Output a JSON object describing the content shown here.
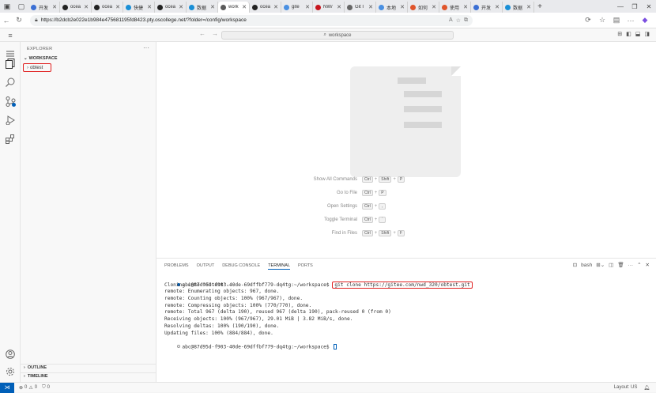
{
  "browser": {
    "tabs": [
      {
        "label": "开发",
        "color": "#3b6fd4"
      },
      {
        "label": "ocea",
        "color": "#222222"
      },
      {
        "label": "ocea",
        "color": "#222222"
      },
      {
        "label": "快捷",
        "color": "#1a8fd6"
      },
      {
        "label": "ocea",
        "color": "#222222"
      },
      {
        "label": "数据",
        "color": "#1a8fd6"
      },
      {
        "label": "work",
        "color": "#5a5a5a"
      },
      {
        "label": "ocea",
        "color": "#222222"
      },
      {
        "label": "gite",
        "color": "#4a90e2"
      },
      {
        "label": "NW/",
        "color": "#c7161e"
      },
      {
        "label": "Git I",
        "color": "#666666"
      },
      {
        "label": "本地",
        "color": "#4a90e2"
      },
      {
        "label": "如何",
        "color": "#e0552b"
      },
      {
        "label": "使用",
        "color": "#e0552b"
      },
      {
        "label": "开发",
        "color": "#3b6fd4"
      },
      {
        "label": "数据",
        "color": "#1a8fd6"
      }
    ],
    "active_tab_index": 6,
    "url": "https://b2dcb2e022e1b984e475681195fd8423.pty.oscollege.net/?folder=/config/workspace"
  },
  "vscode": {
    "command_center": "workspace",
    "explorer_title": "EXPLORER",
    "workspace_label": "WORKSPACE",
    "folder": "obtest",
    "outline": "OUTLINE",
    "timeline": "TIMELINE",
    "shortcuts": [
      {
        "label": "Show All Commands",
        "keys": [
          "Ctrl",
          "Shift",
          "P"
        ]
      },
      {
        "label": "Go to File",
        "keys": [
          "Ctrl",
          "P"
        ]
      },
      {
        "label": "Open Settings",
        "keys": [
          "Ctrl",
          ","
        ]
      },
      {
        "label": "Toggle Terminal",
        "keys": [
          "Ctrl",
          "`"
        ]
      },
      {
        "label": "Find in Files",
        "keys": [
          "Ctrl",
          "Shift",
          "F"
        ]
      }
    ],
    "panel_tabs": [
      "PROBLEMS",
      "OUTPUT",
      "DEBUG CONSOLE",
      "TERMINAL",
      "PORTS"
    ],
    "active_panel_tab": "TERMINAL",
    "terminal_name": "bash",
    "terminal": {
      "prompt": "abc@87d95d-f903-40de-69dffbf779-dq4tg:~/workspace$",
      "command": "git clone https://gitee.com/nwd_320/obtest.git",
      "output": [
        "Cloning into 'obtest'...",
        "remote: Enumerating objects: 967, done.",
        "remote: Counting objects: 100% (967/967), done.",
        "remote: Compressing objects: 100% (770/770), done.",
        "remote: Total 967 (delta 190), reused 967 (delta 190), pack-reused 0 (from 0)",
        "Receiving objects: 100% (967/967), 29.01 MiB | 3.82 MiB/s, done.",
        "Resolving deltas: 100% (190/190), done.",
        "Updating files: 100% (884/884), done."
      ],
      "prompt2": "abc@87d95d-f903-40de-69dffbf779-dq4tg:~/workspace$"
    },
    "status": {
      "errors": "0",
      "warnings": "0",
      "ports": "0",
      "layout": "Layout: US"
    },
    "colors": {
      "accent": "#005fb8",
      "highlight": "#e02020"
    }
  }
}
